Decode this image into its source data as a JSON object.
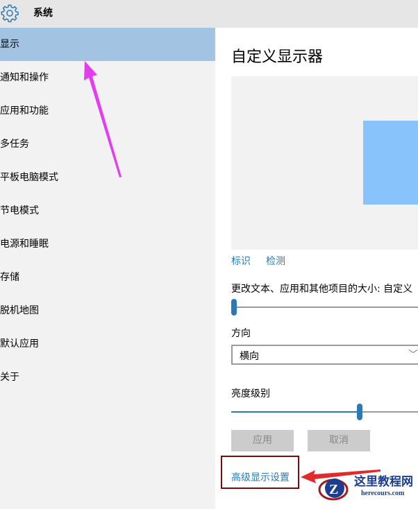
{
  "header": {
    "title": "系统",
    "icon": "gear-icon"
  },
  "sidebar": {
    "items": [
      {
        "label": "显示",
        "selected": true
      },
      {
        "label": "通知和操作"
      },
      {
        "label": "应用和功能"
      },
      {
        "label": "多任务"
      },
      {
        "label": "平板电脑模式"
      },
      {
        "label": "节电模式"
      },
      {
        "label": "电源和睡眠"
      },
      {
        "label": "存储"
      },
      {
        "label": "脱机地图"
      },
      {
        "label": "默认应用"
      },
      {
        "label": "关于"
      }
    ]
  },
  "main": {
    "title": "自定义显示器",
    "identify_link": "标识",
    "detect_link": "检测",
    "scale_label": "更改文本、应用和其他项目的大小: 自定义",
    "scale_value": 0,
    "orientation_label": "方向",
    "orientation_value": "横向",
    "brightness_label": "亮度级别",
    "brightness_value": 0.66,
    "apply_button": "应用",
    "cancel_button": "取消",
    "advanced_link": "高级显示设置"
  },
  "watermark": {
    "name": "这里教程网",
    "url": "herecours.com"
  },
  "colors": {
    "accent": "#2a7ab8",
    "selected": "#a2c4e2",
    "annotation_arrow_1": "#e43df0",
    "annotation_arrow_2": "#e32a2a"
  }
}
